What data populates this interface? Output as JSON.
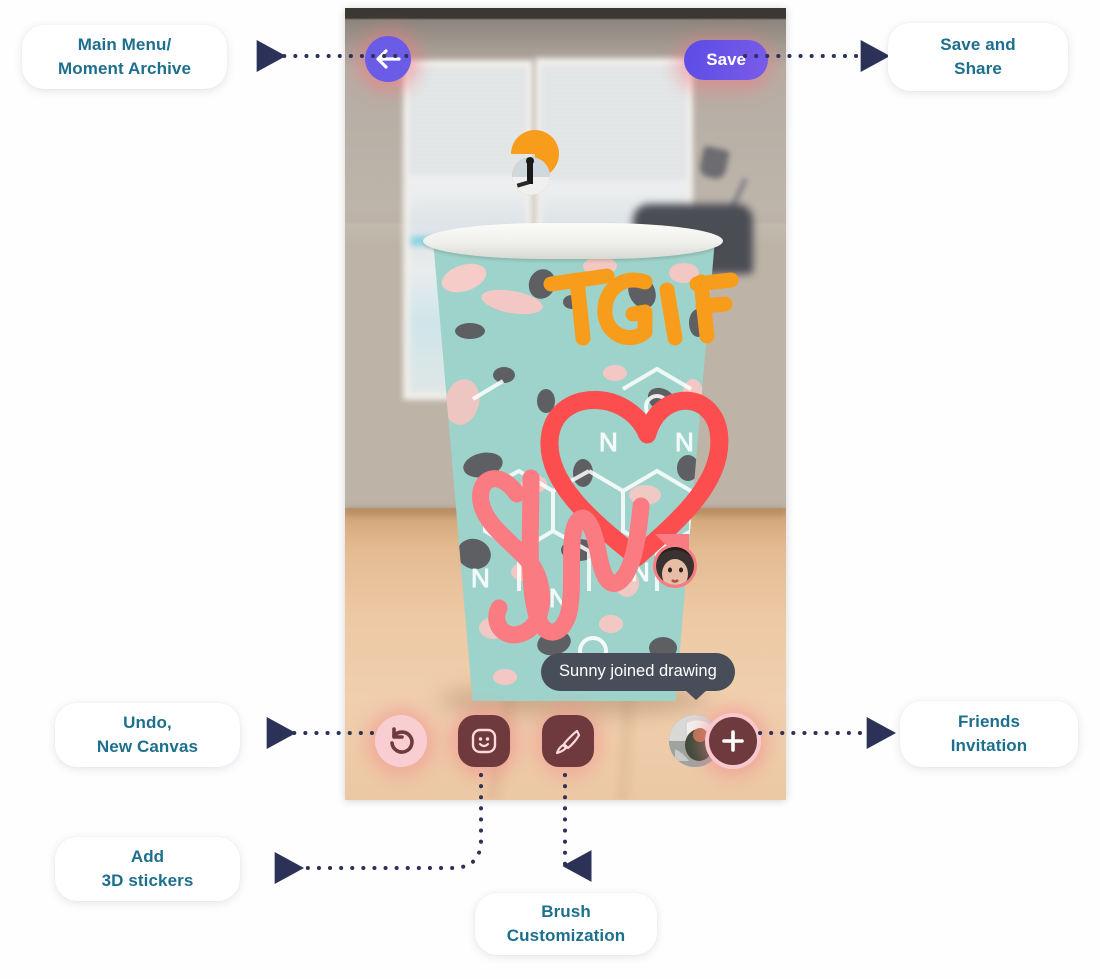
{
  "page": {
    "background_color": "#fdfdfd",
    "label_text_color": "#1d6f8e",
    "connector_color": "#2b3157"
  },
  "annotations": [
    {
      "name": "main-menu",
      "lines": [
        "Main Menu/",
        "Moment Archive"
      ]
    },
    {
      "name": "save-and-share",
      "lines": [
        "Save and",
        "Share"
      ]
    },
    {
      "name": "undo-new-canvas",
      "lines": [
        "Undo,",
        "New Canvas"
      ]
    },
    {
      "name": "friends-invitation",
      "lines": [
        "Friends",
        "Invitation"
      ]
    },
    {
      "name": "add-3d-stickers",
      "lines": [
        "Add",
        "3D stickers"
      ]
    },
    {
      "name": "brush-customization",
      "lines": [
        "Brush",
        "Customization"
      ]
    }
  ],
  "app": {
    "back_button": {
      "icon": "arrow-left-icon",
      "color": "#6b5ce8"
    },
    "save_button": {
      "label": "Save",
      "color": "#6050e7"
    },
    "toast": {
      "text": "Sunny  joined drawing",
      "color": "#474e59"
    },
    "toolbar": [
      {
        "name": "undo-button",
        "icon": "undo-icon",
        "bg": "#f9ced2",
        "fg": "#6e3a3e"
      },
      {
        "name": "sticker-button",
        "icon": "smiley-sticker-icon",
        "bg": "#6e3a3e",
        "fg": "#ffd9dd"
      },
      {
        "name": "brush-button",
        "icon": "paintbrush-icon",
        "bg": "#6e3a3e",
        "fg": "#ffd9dd"
      },
      {
        "name": "add-friend-button",
        "icon": "plus-icon",
        "bg": "#6e3a3e",
        "fg": "#ffffff"
      }
    ],
    "canvas": {
      "subject": "paper cup on wooden table",
      "drawings": [
        {
          "name": "tgif-text",
          "text": "TGIF",
          "color": "#f89c1c"
        },
        {
          "name": "heart-doodle",
          "color": "#fc4e4e"
        },
        {
          "name": "signature-doodle",
          "color": "#fb7b82"
        }
      ],
      "collaborator_pins": [
        {
          "name": "collaborator-pin-orange",
          "color": "#f89c1c"
        },
        {
          "name": "collaborator-pin-pink",
          "color": "#fb7b82"
        }
      ]
    }
  }
}
